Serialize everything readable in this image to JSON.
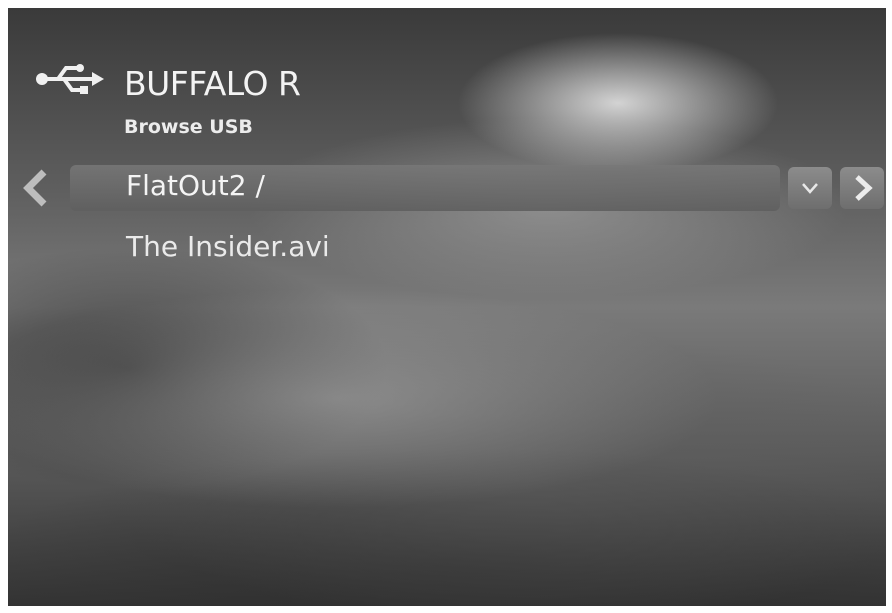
{
  "device": {
    "title": "BUFFALO R",
    "subtitle": "Browse USB",
    "icon": "usb-icon"
  },
  "path_bar": {
    "current_path": "FlatOut2 /",
    "back_icon": "chevron-left-icon",
    "dropdown_icon": "chevron-down-icon",
    "forward_icon": "chevron-right-icon"
  },
  "files": [
    {
      "name": "The Insider.avi"
    }
  ]
}
